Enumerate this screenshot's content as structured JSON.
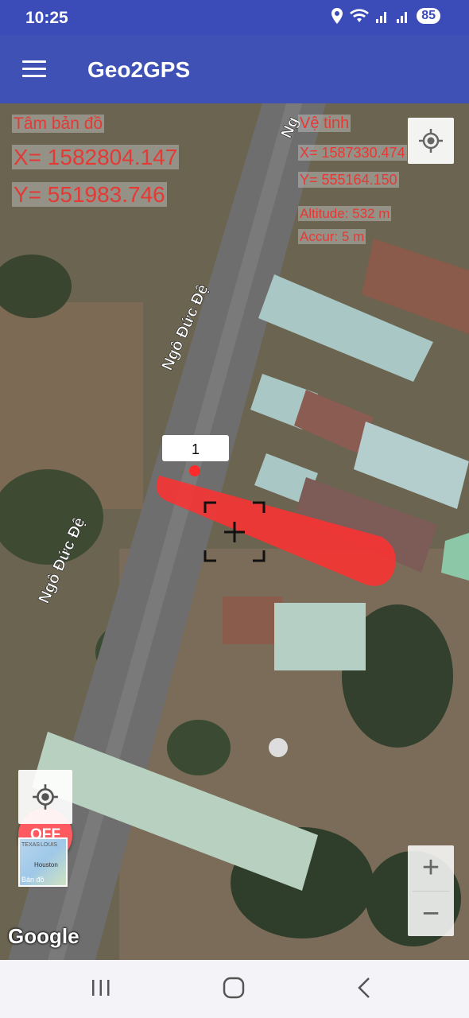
{
  "status_bar": {
    "time": "10:25",
    "battery": "85",
    "icons": [
      "location-icon",
      "wifi-icon",
      "signal-icon",
      "signal-icon"
    ]
  },
  "app_bar": {
    "title": "Geo2GPS",
    "menu_icon": "menu-icon"
  },
  "map_center": {
    "heading": "Tâm bản đồ",
    "x": "X= 1582804.147",
    "y": "Y= 551983.746"
  },
  "satellite": {
    "heading": "Vệ tinh",
    "x": "X= 1587330.474",
    "y": "Y= 555164.150",
    "altitude": "Altitude: 532 m",
    "accuracy": "Accur: 5 m"
  },
  "map": {
    "street_label": "Ngô Đức Đệ",
    "marker_label": "1",
    "off_button": "OFF",
    "layer_thumb": {
      "label": "Bản đồ",
      "texts": [
        "TEXAS",
        "LOUIS",
        "Houston"
      ]
    },
    "attribution": "Google",
    "zoom_in": "+",
    "zoom_out": "−",
    "colors": {
      "accent_red": "#e53935",
      "appbar": "#3f51b5"
    }
  },
  "nav_bar": {
    "buttons": [
      "recents-icon",
      "home-icon",
      "back-icon"
    ]
  }
}
